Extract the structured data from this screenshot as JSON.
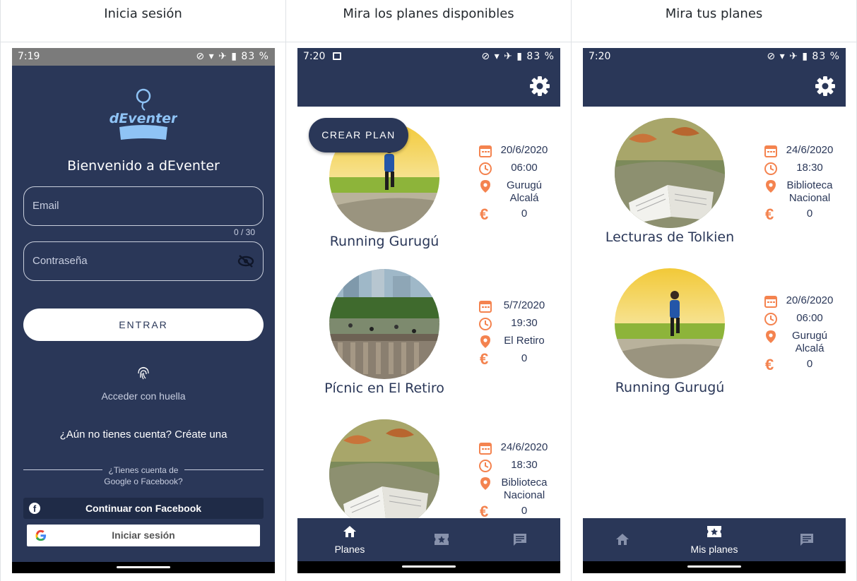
{
  "columns": [
    {
      "heading": "Inicia sesión"
    },
    {
      "heading": "Mira los planes disponibles"
    },
    {
      "heading": "Mira tus planes"
    }
  ],
  "status": {
    "login_time": "7:19",
    "plans_time": "7:20",
    "myplans_time": "7:20",
    "battery": "83 %"
  },
  "login": {
    "logo_text": "dEventer",
    "welcome": "Bienvenido a dEventer",
    "email_placeholder": "Email",
    "email_counter": "0 / 30",
    "password_placeholder": "Contraseña",
    "enter_button": "ENTRAR",
    "fingerprint_label": "Acceder con huella",
    "signup_text": "¿Aún no tienes cuenta? Créate una",
    "social_question_1": "¿Tienes cuenta de",
    "social_question_2": "Google o Facebook?",
    "facebook_button": "Continuar con Facebook",
    "google_button": "Iniciar sesión"
  },
  "available_plans": {
    "fab_label": "CREAR PLAN",
    "plans": [
      {
        "name": "Running Gurugú",
        "date": "20/6/2020",
        "time": "06:00",
        "place_1": "Gurugú",
        "place_2": "Alcalá",
        "price": "0"
      },
      {
        "name": "Pícnic en El Retiro",
        "date": "5/7/2020",
        "time": "19:30",
        "place_1": "El Retiro",
        "place_2": "",
        "price": "0"
      },
      {
        "name": "",
        "date": "24/6/2020",
        "time": "18:30",
        "place_1": "Biblioteca",
        "place_2": "Nacional",
        "price": "0"
      }
    ],
    "nav": [
      {
        "label": "Planes",
        "icon": "home-icon"
      },
      {
        "label": "",
        "icon": "ticket-star-icon"
      },
      {
        "label": "",
        "icon": "chat-icon"
      }
    ]
  },
  "my_plans": {
    "plans": [
      {
        "name": "Lecturas de Tolkien",
        "date": "24/6/2020",
        "time": "18:30",
        "place_1": "Biblioteca",
        "place_2": "Nacional",
        "price": "0"
      },
      {
        "name": "Running Gurugú",
        "date": "20/6/2020",
        "time": "06:00",
        "place_1": "Gurugú",
        "place_2": "Alcalá",
        "price": "0"
      }
    ],
    "nav": [
      {
        "label": "",
        "icon": "home-icon"
      },
      {
        "label": "Mis planes",
        "icon": "ticket-star-icon"
      },
      {
        "label": "",
        "icon": "chat-icon"
      }
    ]
  },
  "colors": {
    "primary": "#2a3758",
    "accent": "#f4834f",
    "logo_blue": "#8fc3f5"
  }
}
